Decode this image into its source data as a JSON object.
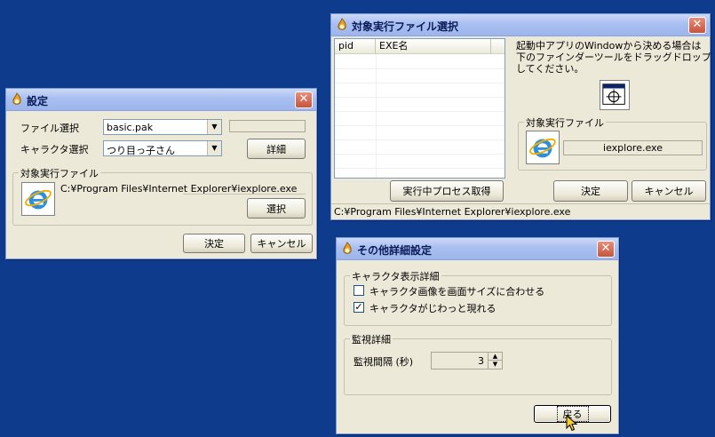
{
  "settings": {
    "title": "設定",
    "file_select_label": "ファイル選択",
    "file_value": "basic.pak",
    "char_select_label": "キャラクタ選択",
    "char_value": "つり目っ子さん",
    "detail_button": "詳細",
    "target_group": "対象実行ファイル",
    "target_path": "C:¥Program Files¥Internet Explorer¥iexplore.exe",
    "select_button": "選択",
    "ok_button": "決定",
    "cancel_button": "キャンセル",
    "close_glyph": "✕"
  },
  "target_select": {
    "title": "対象実行ファイル選択",
    "columns": [
      "pid",
      "EXE名"
    ],
    "instruction_line1": "起動中アプリのWindowから決める場合は",
    "instruction_line2": "下のファインダーツールをドラッグドロップ",
    "instruction_line3": "してください。",
    "target_group": "対象実行ファイル",
    "target_exe": "iexplore.exe",
    "get_process_button": "実行中プロセス取得",
    "ok_button": "決定",
    "cancel_button": "キャンセル",
    "status": "C:¥Program Files¥Internet Explorer¥iexplore.exe",
    "close_glyph": "✕"
  },
  "other_settings": {
    "title": "その他詳細設定",
    "char_display_group": "キャラクタ表示詳細",
    "fit_screen_label": "キャラクタ画像を画面サイズに合わせる",
    "fit_screen_checked": false,
    "fade_in_label": "キャラクタがじわっと現れる",
    "fade_in_checked": true,
    "monitor_group": "監視詳細",
    "interval_label": "監視間隔 (秒)",
    "interval_value": "3",
    "back_button": "戻る",
    "close_glyph": "✕"
  },
  "icons": {
    "app": "app-flame-icon",
    "ie": "internet-explorer-icon",
    "finder": "finder-tool-icon",
    "cursor": "mouse-cursor-icon"
  },
  "colors": {
    "desktop": "#0f3b8c",
    "window": "#ece9d8",
    "close": "#c9533b"
  }
}
